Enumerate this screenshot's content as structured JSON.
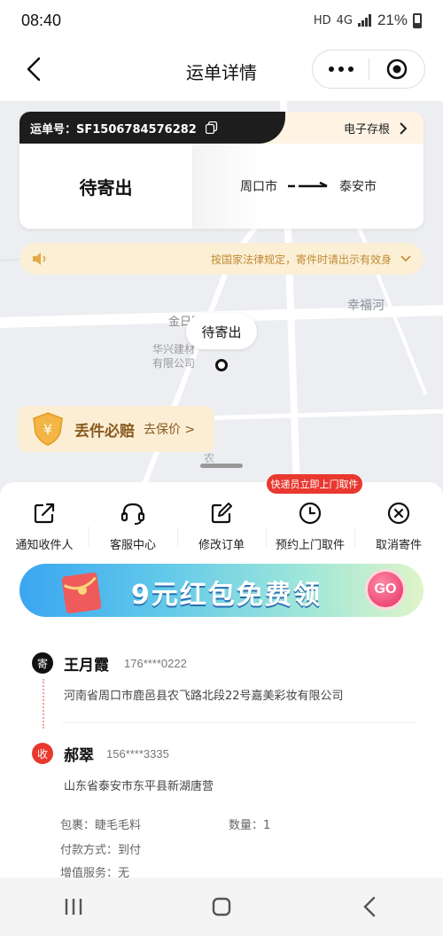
{
  "status_bar": {
    "time": "08:40",
    "network": "HD",
    "signal": "4G",
    "battery": "21%"
  },
  "nav": {
    "title": "运单详情"
  },
  "map_labels": {
    "road1": "金日路",
    "company": "华兴建材\n有限公司",
    "area": "幸福河",
    "road2": "农"
  },
  "waybill": {
    "number_label": "运单号：SF1506784576282",
    "ecopy_label": "电子存根",
    "status": "待寄出",
    "from_city": "周口市",
    "to_city": "泰安市"
  },
  "notice": {
    "text": "按国家法律规定，寄件时请出示有效身"
  },
  "pin": {
    "label": "待寄出"
  },
  "insurance": {
    "title": "丢件必赔",
    "action": "去保价 >"
  },
  "actions": [
    {
      "label": "通知收件人",
      "icon": "share-icon"
    },
    {
      "label": "客服中心",
      "icon": "headset-icon"
    },
    {
      "label": "修改订单",
      "icon": "edit-icon"
    },
    {
      "label": "预约上门取件",
      "icon": "clock-icon"
    },
    {
      "label": "取消寄件",
      "icon": "cancel-icon"
    }
  ],
  "pickup_tag": "快递员立即上门取件",
  "banner": {
    "text": "9元红包免费领",
    "go": "GO"
  },
  "sender": {
    "badge": "寄",
    "name": "王月霞",
    "phone": "176****0222",
    "address": "河南省周口市鹿邑县农飞路北段22号嘉美彩妆有限公司"
  },
  "receiver": {
    "badge": "收",
    "name": "郝翠",
    "phone": "156****3335",
    "address": "山东省泰安市东平县新湖唐营"
  },
  "details": {
    "package": "包裹：睫毛毛料",
    "quantity": "数量：1",
    "payment": "付款方式：到付",
    "service": "增值服务：无"
  },
  "colors": {
    "accent_red": "#e8382f",
    "dark": "#1d1d1d",
    "notice_bg": "#fbefd6"
  }
}
